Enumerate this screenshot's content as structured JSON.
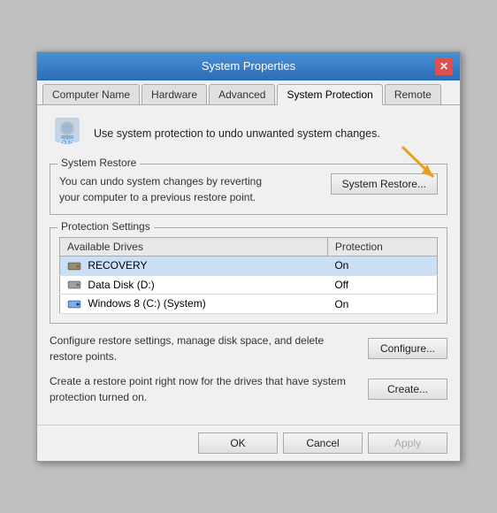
{
  "window": {
    "title": "System Properties",
    "close_label": "✕"
  },
  "tabs": [
    {
      "label": "Computer Name",
      "active": false
    },
    {
      "label": "Hardware",
      "active": false
    },
    {
      "label": "Advanced",
      "active": false
    },
    {
      "label": "System Protection",
      "active": true
    },
    {
      "label": "Remote",
      "active": false
    }
  ],
  "header": {
    "text": "Use system protection to undo unwanted system changes."
  },
  "system_restore": {
    "group_label": "System Restore",
    "desc_line1": "You can undo system changes by reverting",
    "desc_line2": "your computer to a previous restore point.",
    "button_label": "System Restore..."
  },
  "protection_settings": {
    "group_label": "Protection Settings",
    "table": {
      "col_drives": "Available Drives",
      "col_protection": "Protection",
      "rows": [
        {
          "drive": "RECOVERY",
          "protection": "On",
          "highlight": true,
          "icon": "hdd"
        },
        {
          "drive": "Data Disk (D:)",
          "protection": "Off",
          "highlight": false,
          "icon": "hdd"
        },
        {
          "drive": "Windows 8 (C:) (System)",
          "protection": "On",
          "highlight": false,
          "icon": "hdd-system"
        }
      ]
    }
  },
  "configure_section": {
    "text": "Configure restore settings, manage disk space, and\ndelete restore points.",
    "button_label": "Configure..."
  },
  "create_section": {
    "text": "Create a restore point right now for the drives that\nhave system protection turned on.",
    "button_label": "Create..."
  },
  "footer": {
    "ok_label": "OK",
    "cancel_label": "Cancel",
    "apply_label": "Apply"
  }
}
